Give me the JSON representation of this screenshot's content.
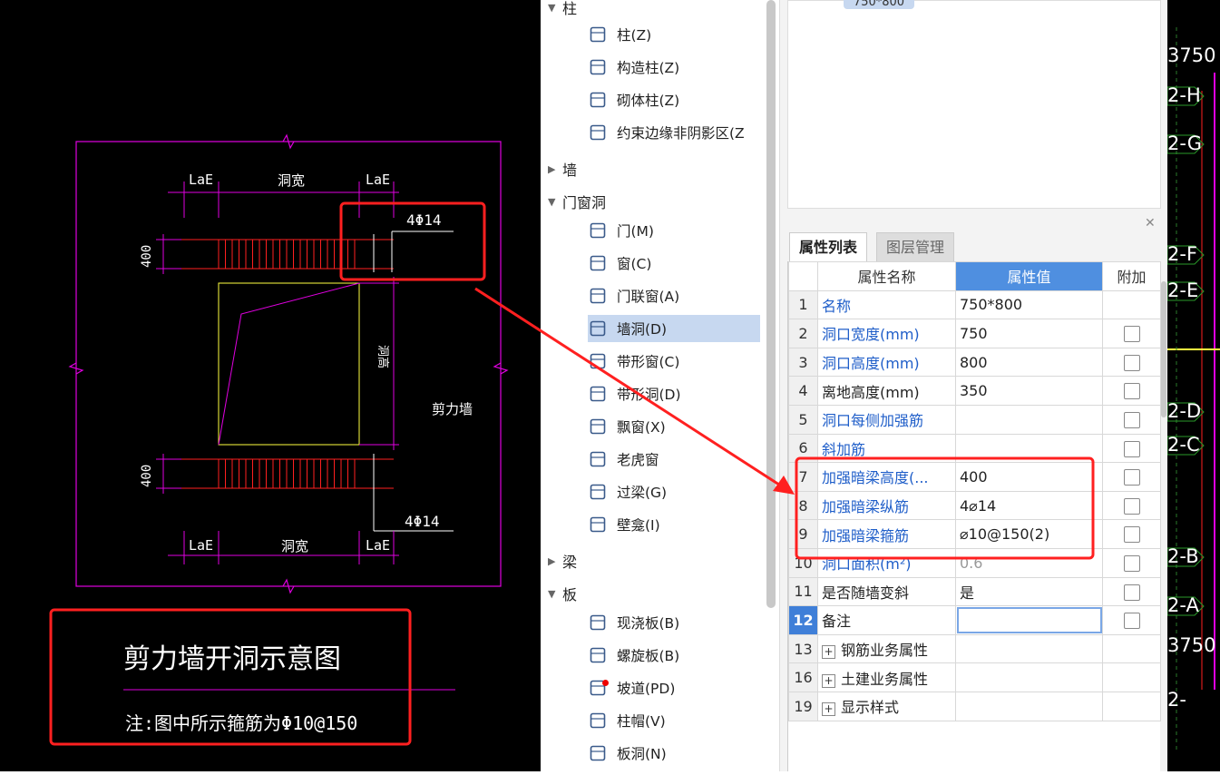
{
  "drawing": {
    "lae": "LaE",
    "opening_width": "洞宽",
    "opening_height": "洞高",
    "dim_400": "400",
    "rebar_label": "4Φ14",
    "wall_label": "剪力墙",
    "title": "剪力墙开洞示意图",
    "note": "注:图中所示箍筋为Φ10@150"
  },
  "tree": {
    "groups": [
      {
        "label": "柱",
        "expanded": true
      },
      {
        "label": "墙",
        "expanded": false
      },
      {
        "label": "门窗洞",
        "expanded": true
      },
      {
        "label": "梁",
        "expanded": false
      },
      {
        "label": "板",
        "expanded": true
      }
    ],
    "items": [
      {
        "label": "柱(Z)",
        "icon": "column-icon"
      },
      {
        "label": "构造柱(Z)",
        "icon": "constructional-column-icon"
      },
      {
        "label": "砌体柱(Z)",
        "icon": "masonry-column-icon"
      },
      {
        "label": "约束边缘非阴影区(Z",
        "icon": "boundary-zone-icon"
      },
      {
        "label": "门(M)",
        "icon": "door-icon"
      },
      {
        "label": "窗(C)",
        "icon": "window-icon"
      },
      {
        "label": "门联窗(A)",
        "icon": "door-window-icon"
      },
      {
        "label": "墙洞(D)",
        "icon": "wall-opening-icon",
        "selected": true
      },
      {
        "label": "带形窗(C)",
        "icon": "strip-window-icon"
      },
      {
        "label": "带形洞(D)",
        "icon": "strip-opening-icon"
      },
      {
        "label": "飘窗(X)",
        "icon": "bay-window-icon"
      },
      {
        "label": "老虎窗",
        "icon": "dormer-icon"
      },
      {
        "label": "过梁(G)",
        "icon": "lintel-icon"
      },
      {
        "label": "壁龛(I)",
        "icon": "niche-icon"
      },
      {
        "label": "现浇板(B)",
        "icon": "cast-slab-icon"
      },
      {
        "label": "螺旋板(B)",
        "icon": "spiral-slab-icon"
      },
      {
        "label": "坡道(PD)",
        "icon": "ramp-icon"
      },
      {
        "label": "柱帽(V)",
        "icon": "column-cap-icon"
      },
      {
        "label": "板洞(N)",
        "icon": "slab-opening-icon"
      }
    ]
  },
  "preview": {
    "badge": "750*800"
  },
  "properties": {
    "tabs": [
      "属性列表",
      "图层管理"
    ],
    "headers": [
      "属性名称",
      "属性值",
      "附加"
    ],
    "rows": [
      {
        "no": "1",
        "name": "名称",
        "value": "750*800",
        "style": "blue",
        "check": false
      },
      {
        "no": "2",
        "name": "洞口宽度(mm)",
        "value": "750",
        "style": "blue",
        "check": true
      },
      {
        "no": "3",
        "name": "洞口高度(mm)",
        "value": "800",
        "style": "blue",
        "check": true
      },
      {
        "no": "4",
        "name": "离地高度(mm)",
        "value": "350",
        "style": "black",
        "check": true
      },
      {
        "no": "5",
        "name": "洞口每侧加强筋",
        "value": "",
        "style": "blue",
        "check": true
      },
      {
        "no": "6",
        "name": "斜加筋",
        "value": "",
        "style": "blue",
        "check": true
      },
      {
        "no": "7",
        "name": "加强暗梁高度(...",
        "value": "400",
        "style": "blue",
        "check": true
      },
      {
        "no": "8",
        "name": "加强暗梁纵筋",
        "value": "4⌀14",
        "style": "blue",
        "check": true
      },
      {
        "no": "9",
        "name": "加强暗梁箍筋",
        "value": "⌀10@150(2)",
        "style": "blue",
        "check": true
      },
      {
        "no": "10",
        "name": "洞口面积(m²)",
        "value": "0.6",
        "style": "blue",
        "check": true
      },
      {
        "no": "11",
        "name": "是否随墙变斜",
        "value": "是",
        "style": "black",
        "check": true
      },
      {
        "no": "12",
        "name": "备注",
        "value": "",
        "style": "black",
        "check": true,
        "selected": true
      },
      {
        "no": "13",
        "name": "钢筋业务属性",
        "value": "",
        "style": "group",
        "check": false
      },
      {
        "no": "16",
        "name": "土建业务属性",
        "value": "",
        "style": "group",
        "check": false
      },
      {
        "no": "19",
        "name": "显示样式",
        "value": "",
        "style": "group",
        "check": false
      }
    ]
  },
  "axis_labels": [
    "3750",
    "2-H",
    "2-G",
    "2-F",
    "2-E",
    "2-D",
    "2-C",
    "2-B",
    "2-A",
    "3750",
    "2-"
  ],
  "colors": {
    "magenta": "#e000e0",
    "red": "#ff2020",
    "yellow": "#ffff40",
    "selection": "#c7d8f0",
    "header": "#4f8fe0",
    "link": "#1f5ec9"
  }
}
